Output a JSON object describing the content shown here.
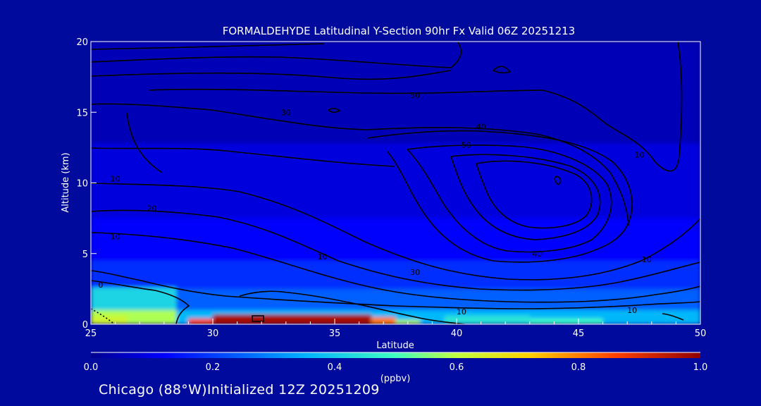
{
  "chart_data": {
    "type": "heatmap",
    "title": "FORMALDEHYDE Latitudinal Y-Section 90hr  Fx Valid 06Z 20251213",
    "xlabel": "Latitude",
    "ylabel": "Altitude (km)",
    "xlim": [
      25,
      50
    ],
    "ylim": [
      0,
      20
    ],
    "x_ticks": [
      "25",
      "30",
      "35",
      "40",
      "45",
      "50"
    ],
    "y_ticks": [
      "0",
      "5",
      "10",
      "15",
      "20"
    ],
    "x_tick_values": [
      25,
      30,
      35,
      40,
      45,
      50
    ],
    "y_tick_values": [
      0,
      5,
      10,
      15,
      20
    ],
    "colorbar": {
      "unit_label": "(ppbv)",
      "range": [
        0.0,
        1.0
      ],
      "tick_labels": [
        "0.0",
        "0.2",
        "0.4",
        "0.6",
        "0.8",
        "1.0"
      ],
      "tick_values": [
        0.0,
        0.2,
        0.4,
        0.6,
        0.8,
        1.0
      ],
      "colormap": [
        "#00008f",
        "#0000ff",
        "#00b0ff",
        "#40ffc0",
        "#c0ff40",
        "#ffd000",
        "#ff4000",
        "#8f0000"
      ]
    },
    "concentration_regions": [
      {
        "lat": [
          25,
          50
        ],
        "alt": [
          0,
          20
        ],
        "value": 0.05
      },
      {
        "lat": [
          25,
          50
        ],
        "alt": [
          7.5,
          12.8
        ],
        "value": 0.1
      },
      {
        "lat": [
          25,
          50
        ],
        "alt": [
          4.5,
          7.5
        ],
        "value": 0.14
      },
      {
        "lat": [
          25,
          50
        ],
        "alt": [
          2.5,
          4.5
        ],
        "value": 0.18
      },
      {
        "lat": [
          25,
          50
        ],
        "alt": [
          1.0,
          2.5
        ],
        "value": 0.22
      },
      {
        "lat": [
          25,
          28.5
        ],
        "alt": [
          1.0,
          2.6
        ],
        "value": 0.35
      },
      {
        "lat": [
          25,
          28.5
        ],
        "alt": [
          0,
          1.0
        ],
        "value": 0.55
      },
      {
        "lat": [
          25,
          26.5
        ],
        "alt": [
          0,
          0.6
        ],
        "value": 0.6
      },
      {
        "lat": [
          28.5,
          50
        ],
        "alt": [
          0,
          1.0
        ],
        "value": 0.3
      },
      {
        "lat": [
          29.0,
          30.0
        ],
        "alt": [
          0,
          0.4
        ],
        "value": 0.85
      },
      {
        "lat": [
          30.0,
          36.5
        ],
        "alt": [
          0,
          0.7
        ],
        "value": 0.97
      },
      {
        "lat": [
          36.5,
          37.5
        ],
        "alt": [
          0,
          0.5
        ],
        "value": 0.8
      },
      {
        "lat": [
          37.5,
          38.5
        ],
        "alt": [
          0,
          0.3
        ],
        "value": 0.55
      },
      {
        "lat": [
          39.5,
          43.0
        ],
        "alt": [
          0,
          0.6
        ],
        "value": 0.38
      },
      {
        "lat": [
          43.0,
          46.0
        ],
        "alt": [
          0,
          0.4
        ],
        "value": 0.42
      },
      {
        "lat": [
          46.0,
          48.0
        ],
        "alt": [
          0,
          0.3
        ],
        "value": 0.3
      }
    ],
    "contour_labels": [
      {
        "text": "30",
        "lat": 33.0,
        "alt": 15.0
      },
      {
        "text": "50",
        "lat": 38.3,
        "alt": 16.2
      },
      {
        "text": "40",
        "lat": 41.0,
        "alt": 14.0
      },
      {
        "text": "50",
        "lat": 40.4,
        "alt": 12.7
      },
      {
        "text": "20",
        "lat": 27.5,
        "alt": 8.2
      },
      {
        "text": "10",
        "lat": 26.0,
        "alt": 10.3
      },
      {
        "text": "10",
        "lat": 26.0,
        "alt": 6.2
      },
      {
        "text": "10",
        "lat": 34.5,
        "alt": 4.8
      },
      {
        "text": "0",
        "lat": 25.4,
        "alt": 2.8
      },
      {
        "text": "10",
        "lat": 40.2,
        "alt": 0.9
      },
      {
        "text": "30",
        "lat": 38.3,
        "alt": 3.7
      },
      {
        "text": "40",
        "lat": 43.3,
        "alt": 5.0
      },
      {
        "text": "10",
        "lat": 47.8,
        "alt": 4.6
      },
      {
        "text": "10",
        "lat": 47.2,
        "alt": 1.0
      },
      {
        "text": "10",
        "lat": 47.5,
        "alt": 12.0
      },
      {
        "text": "30",
        "lat": 33.0,
        "alt": 15.0
      }
    ]
  },
  "footer": {
    "location_info": "Chicago (88°W)Initialized 12Z 20251209"
  }
}
